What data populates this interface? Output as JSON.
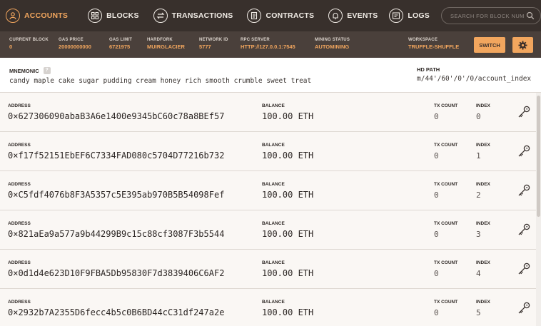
{
  "nav": {
    "items": [
      {
        "label": "ACCOUNTS",
        "icon": "accounts-icon",
        "active": true
      },
      {
        "label": "BLOCKS",
        "icon": "blocks-icon",
        "active": false
      },
      {
        "label": "TRANSACTIONS",
        "icon": "transactions-icon",
        "active": false
      },
      {
        "label": "CONTRACTS",
        "icon": "contracts-icon",
        "active": false
      },
      {
        "label": "EVENTS",
        "icon": "events-icon",
        "active": false
      },
      {
        "label": "LOGS",
        "icon": "logs-icon",
        "active": false
      }
    ],
    "search_placeholder": "SEARCH FOR BLOCK NUMBERS OR TX HASHES"
  },
  "status": {
    "current_block": {
      "label": "CURRENT BLOCK",
      "value": "0"
    },
    "gas_price": {
      "label": "GAS PRICE",
      "value": "20000000000"
    },
    "gas_limit": {
      "label": "GAS LIMIT",
      "value": "6721975"
    },
    "hardfork": {
      "label": "HARDFORK",
      "value": "MUIRGLACIER"
    },
    "network_id": {
      "label": "NETWORK ID",
      "value": "5777"
    },
    "rpc_server": {
      "label": "RPC SERVER",
      "value": "HTTP://127.0.0.1:7545"
    },
    "mining_status": {
      "label": "MINING STATUS",
      "value": "AUTOMINING"
    },
    "workspace": {
      "label": "WORKSPACE",
      "value": "TRUFFLE-SHUFFLE"
    },
    "switch_label": "SWITCH"
  },
  "mnemonic": {
    "label": "MNEMONIC",
    "value": "candy maple cake sugar pudding cream honey rich smooth crumble sweet treat",
    "hd_label": "HD PATH",
    "hd_value": "m/44'/60'/0'/0/account_index"
  },
  "labels": {
    "address": "ADDRESS",
    "balance": "BALANCE",
    "tx_count": "TX COUNT",
    "index": "INDEX"
  },
  "accounts": [
    {
      "address": "0×627306090abaB3A6e1400e9345bC60c78a8BEf57",
      "balance": "100.00 ETH",
      "tx_count": "0",
      "index": "0"
    },
    {
      "address": "0×f17f52151EbEF6C7334FAD080c5704D77216b732",
      "balance": "100.00 ETH",
      "tx_count": "0",
      "index": "1"
    },
    {
      "address": "0×C5fdf4076b8F3A5357c5E395ab970B5B54098Fef",
      "balance": "100.00 ETH",
      "tx_count": "0",
      "index": "2"
    },
    {
      "address": "0×821aEa9a577a9b44299B9c15c88cf3087F3b5544",
      "balance": "100.00 ETH",
      "tx_count": "0",
      "index": "3"
    },
    {
      "address": "0×0d1d4e623D10F9FBA5Db95830F7d3839406C6AF2",
      "balance": "100.00 ETH",
      "tx_count": "0",
      "index": "4"
    },
    {
      "address": "0×2932b7A2355D6fecc4b5c0B6BD44cC31df247a2e",
      "balance": "100.00 ETH",
      "tx_count": "0",
      "index": "5"
    }
  ],
  "colors": {
    "accent": "#f2a65e",
    "nav_bg": "#38302c",
    "status_bg": "#4a403b"
  }
}
